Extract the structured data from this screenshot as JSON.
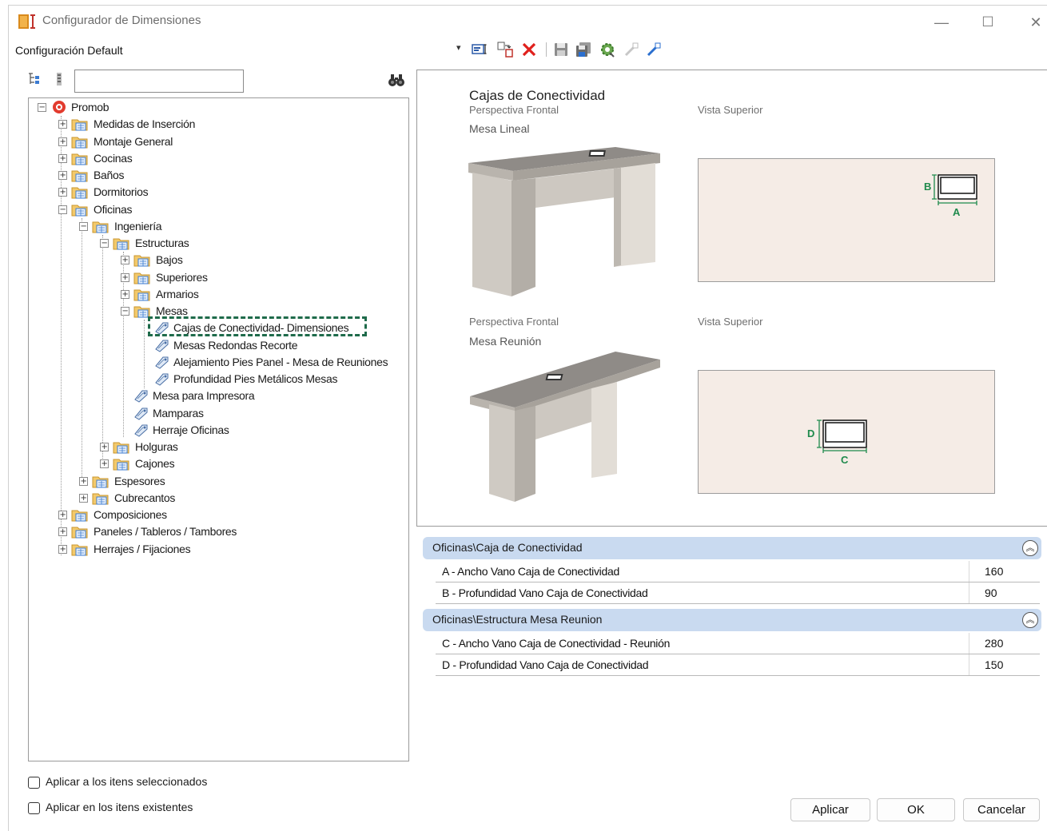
{
  "window": {
    "title": "Configurador de Dimensiones",
    "controls": {
      "minimize": "—",
      "maximize": "☐",
      "close": "✕"
    }
  },
  "config": {
    "label": "Configuración Default",
    "dropdown_arrow": "▾"
  },
  "toolbar_icons": [
    "properties-icon",
    "copy-config-icon",
    "delete-icon",
    "save-icon",
    "save-as-icon",
    "settings-gear-icon",
    "import-icon",
    "export-icon"
  ],
  "tree_toolbar": {
    "search_value": "",
    "expand_icon": "tree-expand-icon",
    "collapse_icon": "tree-collapse-icon",
    "find_icon": "binoculars-icon"
  },
  "tree": {
    "root": "Promob",
    "items": [
      {
        "label": "Medidas de Inserción",
        "state": "+"
      },
      {
        "label": "Montaje General",
        "state": "+"
      },
      {
        "label": "Cocinas",
        "state": "+"
      },
      {
        "label": "Baños",
        "state": "+"
      },
      {
        "label": "Dormitorios",
        "state": "+"
      },
      {
        "label": "Oficinas",
        "state": "-"
      },
      {
        "label": "Ingeniería",
        "state": "-"
      },
      {
        "label": "Estructuras",
        "state": "-"
      },
      {
        "label": "Bajos",
        "state": "+"
      },
      {
        "label": "Superiores",
        "state": "+"
      },
      {
        "label": "Armarios",
        "state": "+"
      },
      {
        "label": "Mesas",
        "state": "-"
      },
      {
        "label": "Cajas de Conectividad- Dimensiones"
      },
      {
        "label": "Mesas Redondas Recorte"
      },
      {
        "label": "Alejamiento Pies Panel - Mesa de Reuniones"
      },
      {
        "label": "Profundidad Pies Metálicos Mesas"
      },
      {
        "label": "Mesa para Impresora"
      },
      {
        "label": "Mamparas"
      },
      {
        "label": "Herraje Oficinas"
      },
      {
        "label": "Holguras",
        "state": "+"
      },
      {
        "label": "Cajones",
        "state": "+"
      },
      {
        "label": "Espesores",
        "state": "+"
      },
      {
        "label": "Cubrecantos",
        "state": "+"
      },
      {
        "label": "Composiciones",
        "state": "+"
      },
      {
        "label": "Paneles / Tableros / Tambores",
        "state": "+"
      },
      {
        "label": "Herrajes / Fijaciones",
        "state": "+"
      }
    ]
  },
  "options": {
    "apply_selected": "Aplicar a los itens seleccionados",
    "apply_existing": "Aplicar en los itens existentes",
    "apply_selected_checked": false,
    "apply_existing_checked": false
  },
  "preview": {
    "title": "Cajas de Conectividad",
    "top_persp": "Perspectiva Frontal",
    "top_view": "Vista Superior",
    "top_desk": "Mesa Lineal",
    "bottom_persp": "Perspectiva Frontal",
    "bottom_view": "Vista Superior",
    "bottom_desk": "Mesa Reunión",
    "dims": {
      "a": "A",
      "b": "B",
      "c": "C",
      "d": "D"
    },
    "colors": {
      "desk_top": "#8d8a86",
      "desk_side": "#d8d4ce",
      "topview_bg": "#f5ece6",
      "dim_line": "#1f8a4c"
    }
  },
  "groups": [
    {
      "title": "Oficinas\\Caja de Conectividad",
      "collapse": "︽",
      "rows": [
        {
          "label": "A - Ancho Vano Caja de Conectividad",
          "value": "160"
        },
        {
          "label": "B - Profundidad Vano Caja de Conectividad",
          "value": "90"
        }
      ]
    },
    {
      "title": "Oficinas\\Estructura Mesa Reunion",
      "collapse": "︽",
      "rows": [
        {
          "label": "C - Ancho Vano Caja de Conectividad - Reunión",
          "value": "280"
        },
        {
          "label": "D - Profundidad Vano Caja de Conectividad",
          "value": "150"
        }
      ]
    }
  ],
  "buttons": {
    "apply": "Aplicar",
    "ok": "OK",
    "cancel": "Cancelar"
  }
}
